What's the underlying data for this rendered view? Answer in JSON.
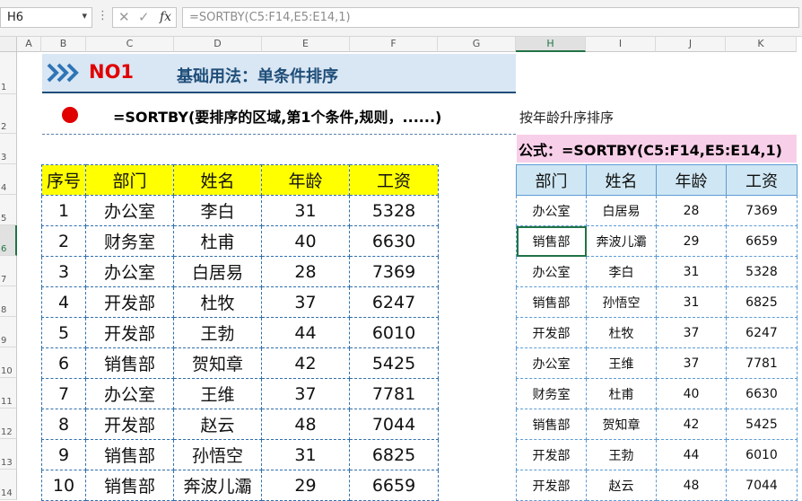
{
  "formula_bar": {
    "name_box": "H6",
    "formula": "=SORTBY(C5:F14,E5:E14,1)",
    "cancel_icon": "cross-icon",
    "enter_icon": "check-icon",
    "fx_label": "fx"
  },
  "columns": [
    "A",
    "B",
    "C",
    "D",
    "E",
    "F",
    "G",
    "H",
    "I",
    "J",
    "K"
  ],
  "rows": [
    "1",
    "2",
    "3",
    "4",
    "5",
    "6",
    "7",
    "8",
    "9",
    "10",
    "11",
    "12",
    "13",
    "14"
  ],
  "banner": {
    "tag": "NO1",
    "title": "基础用法：单条件排序"
  },
  "syntax": "=SORTBY(要排序的区域,第1个条件,规则，......)",
  "note": "按年龄升序排序",
  "formula_label": "公式：=SORTBY(C5:F14,E5:E14,1)",
  "source_table": {
    "headers": [
      "序号",
      "部门",
      "姓名",
      "年龄",
      "工资"
    ],
    "rows": [
      [
        "1",
        "办公室",
        "李白",
        "31",
        "5328"
      ],
      [
        "2",
        "财务室",
        "杜甫",
        "40",
        "6630"
      ],
      [
        "3",
        "办公室",
        "白居易",
        "28",
        "7369"
      ],
      [
        "4",
        "开发部",
        "杜牧",
        "37",
        "6247"
      ],
      [
        "5",
        "开发部",
        "王勃",
        "44",
        "6010"
      ],
      [
        "6",
        "销售部",
        "贺知章",
        "42",
        "5425"
      ],
      [
        "7",
        "办公室",
        "王维",
        "37",
        "7781"
      ],
      [
        "8",
        "开发部",
        "赵云",
        "48",
        "7044"
      ],
      [
        "9",
        "销售部",
        "孙悟空",
        "31",
        "6825"
      ],
      [
        "10",
        "销售部",
        "奔波儿灞",
        "29",
        "6659"
      ]
    ]
  },
  "result_table": {
    "headers": [
      "部门",
      "姓名",
      "年龄",
      "工资"
    ],
    "rows": [
      [
        "办公室",
        "白居易",
        "28",
        "7369"
      ],
      [
        "销售部",
        "奔波儿灞",
        "29",
        "6659"
      ],
      [
        "办公室",
        "李白",
        "31",
        "5328"
      ],
      [
        "销售部",
        "孙悟空",
        "31",
        "6825"
      ],
      [
        "开发部",
        "杜牧",
        "37",
        "6247"
      ],
      [
        "办公室",
        "王维",
        "37",
        "7781"
      ],
      [
        "财务室",
        "杜甫",
        "40",
        "6630"
      ],
      [
        "销售部",
        "贺知章",
        "42",
        "5425"
      ],
      [
        "开发部",
        "王勃",
        "44",
        "6010"
      ],
      [
        "开发部",
        "赵云",
        "48",
        "7044"
      ]
    ]
  },
  "colors": {
    "banner_bg": "#d9e6f3",
    "header_yellow": "#ffff00",
    "header_blue": "#cfe7f4",
    "formula_pink": "#f8cfe8",
    "accent_red": "#e00000",
    "selection_green": "#217346"
  }
}
